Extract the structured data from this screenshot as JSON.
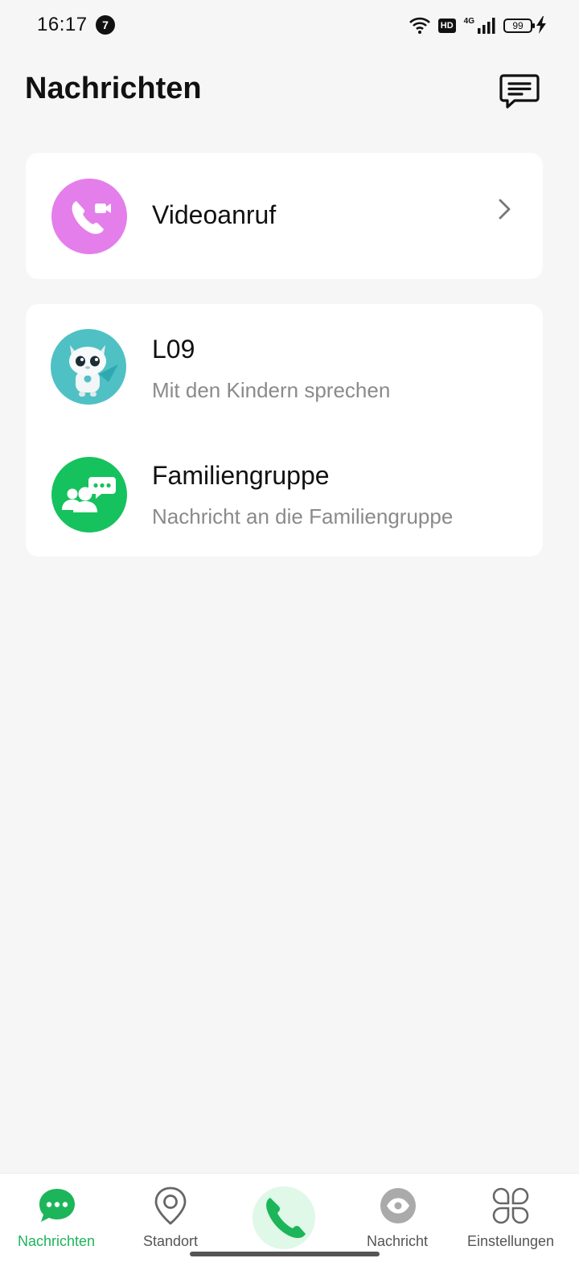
{
  "status_bar": {
    "time": "16:17",
    "notification_count": "7",
    "hd_label": "HD",
    "network_label": "4G",
    "battery_level": "99"
  },
  "header": {
    "title": "Nachrichten"
  },
  "video_call": {
    "label": "Videoanruf"
  },
  "chats": [
    {
      "title": "L09",
      "subtitle": "Mit den Kindern sprechen"
    },
    {
      "title": "Familiengruppe",
      "subtitle": "Nachricht an die Familiengruppe"
    }
  ],
  "bottom_nav": {
    "items": [
      {
        "label": "Nachrichten",
        "icon": "chat-bubble-icon",
        "active": true
      },
      {
        "label": "Standort",
        "icon": "location-pin-icon",
        "active": false
      },
      {
        "label": "",
        "icon": "phone-icon",
        "active": false
      },
      {
        "label": "Nachricht",
        "icon": "eye-icon",
        "active": false
      },
      {
        "label": "Einstellungen",
        "icon": "apps-grid-icon",
        "active": false
      }
    ]
  },
  "colors": {
    "accent_green": "#1db55a",
    "video_avatar": "#e47eea",
    "l09_avatar": "#4fc1c4",
    "family_avatar": "#16c25d",
    "background": "#f6f6f6"
  }
}
